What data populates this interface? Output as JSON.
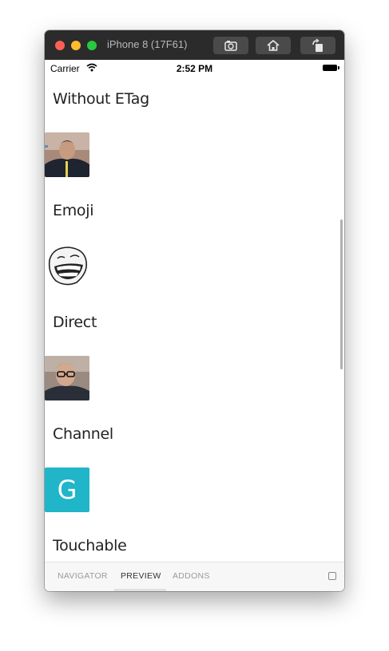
{
  "window": {
    "title": "iPhone 8 (17F61)"
  },
  "statusbar": {
    "carrier": "Carrier",
    "time": "2:52 PM"
  },
  "sections": [
    {
      "label": "Without ETag"
    },
    {
      "label": "Emoji"
    },
    {
      "label": "Direct"
    },
    {
      "label": "Channel"
    },
    {
      "label": "Touchable"
    }
  ],
  "channel_avatar": {
    "letter": "G",
    "color": "#20b5c8"
  },
  "tabs": [
    {
      "label": "NAVIGATOR"
    },
    {
      "label": "PREVIEW"
    },
    {
      "label": "ADDONS"
    }
  ]
}
